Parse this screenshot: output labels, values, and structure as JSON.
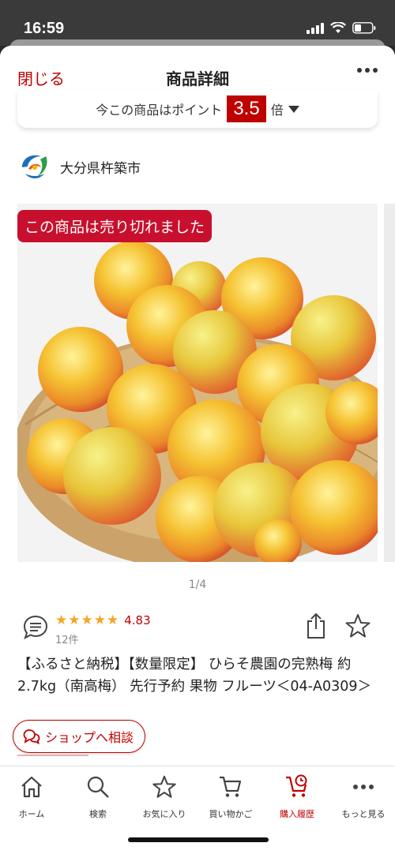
{
  "status_bar": {
    "time": "16:59"
  },
  "header": {
    "close_label": "閉じる",
    "title": "商品詳細"
  },
  "points": {
    "prefix": "今この商品はポイント",
    "value": "3.5",
    "suffix": "倍"
  },
  "shop": {
    "name": "大分県杵築市",
    "logo_icon": "municipal-logo-icon"
  },
  "gallery": {
    "badge": "この商品は売り切れました",
    "page_indicator": "1/4"
  },
  "review": {
    "stars": [
      "★",
      "★",
      "★",
      "★",
      "★"
    ],
    "rating": "4.83",
    "count": "12件"
  },
  "product": {
    "title": "【ふるさと納税】【数量限定】 ひらそ農園の完熟梅 約2.7kg（南高梅） 先行予約 果物 フルーツ＜04-A0309＞"
  },
  "consult": {
    "label": "ショップへ相談"
  },
  "tabbar": {
    "items": [
      {
        "label": "ホーム",
        "icon": "home-icon"
      },
      {
        "label": "検索",
        "icon": "search-icon"
      },
      {
        "label": "お気に入り",
        "icon": "star-icon"
      },
      {
        "label": "買い物かご",
        "icon": "cart-icon"
      },
      {
        "label": "購入履歴",
        "icon": "purchase-history-icon"
      },
      {
        "label": "もっと見る",
        "icon": "more-icon"
      }
    ]
  },
  "colors": {
    "accent": "#bf0000",
    "star": "#f5a623",
    "soldout": "#c8102e"
  }
}
